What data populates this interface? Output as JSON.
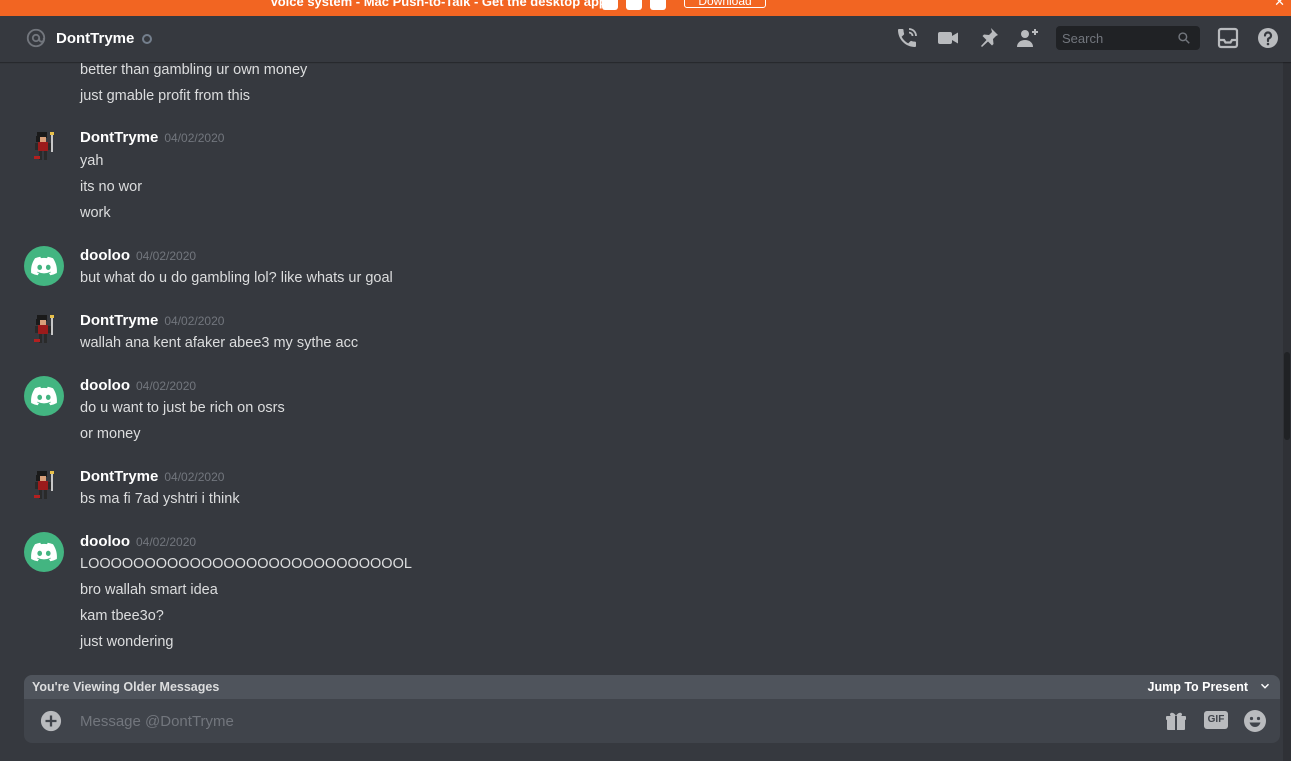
{
  "banner": {
    "text": "Voice system - Mac Push-to-Talk - Get the desktop app!",
    "download_label": "Download",
    "close_glyph": "✕",
    "icons": [
      "apple-icon",
      "android-icon",
      "windows-icon"
    ]
  },
  "header": {
    "channel_name": "DontTryme",
    "status": "offline",
    "search_placeholder": "Search",
    "icons": [
      "at-icon",
      "call-icon",
      "video-icon",
      "pin-icon",
      "add-friend-icon",
      "search-icon",
      "inbox-icon",
      "help-icon"
    ]
  },
  "messages": {
    "continuation": [
      "better than gambling ur own money",
      "just gmable profit from this"
    ],
    "groups": [
      {
        "author": "DontTryme",
        "timestamp": "04/02/2020",
        "avatar": "pixel-character-avatar",
        "lines": [
          "yah",
          "its no wor",
          "work"
        ]
      },
      {
        "author": "dooloo",
        "timestamp": "04/02/2020",
        "avatar": "discord-logo-avatar",
        "lines": [
          "but what do u do gambling lol? like whats ur goal"
        ]
      },
      {
        "author": "DontTryme",
        "timestamp": "04/02/2020",
        "avatar": "pixel-character-avatar",
        "lines": [
          "wallah ana kent afaker abee3 my sythe acc"
        ]
      },
      {
        "author": "dooloo",
        "timestamp": "04/02/2020",
        "avatar": "discord-logo-avatar",
        "lines": [
          "do u want to just be rich on osrs",
          "or money"
        ]
      },
      {
        "author": "DontTryme",
        "timestamp": "04/02/2020",
        "avatar": "pixel-character-avatar",
        "lines": [
          "bs ma fi 7ad yshtri i think"
        ]
      },
      {
        "author": "dooloo",
        "timestamp": "04/02/2020",
        "avatar": "discord-logo-avatar",
        "lines": [
          "LOOOOOOOOOOOOOOOOOOOOOOOOOOOOL",
          "bro wallah smart idea",
          "kam tbee3o?",
          "just wondering"
        ]
      }
    ]
  },
  "older_bar": {
    "text": "You're Viewing Older Messages",
    "jump_label": "Jump To Present"
  },
  "composer": {
    "placeholder": "Message @DontTryme",
    "gif_label": "GIF",
    "icons": [
      "add-attachment-icon",
      "gift-icon",
      "emoji-icon"
    ]
  },
  "colors": {
    "background": "#36393f",
    "banner": "#f26522",
    "discord_avatar": "#43b581",
    "composer": "#40444b",
    "older_bar": "#4f545c"
  }
}
